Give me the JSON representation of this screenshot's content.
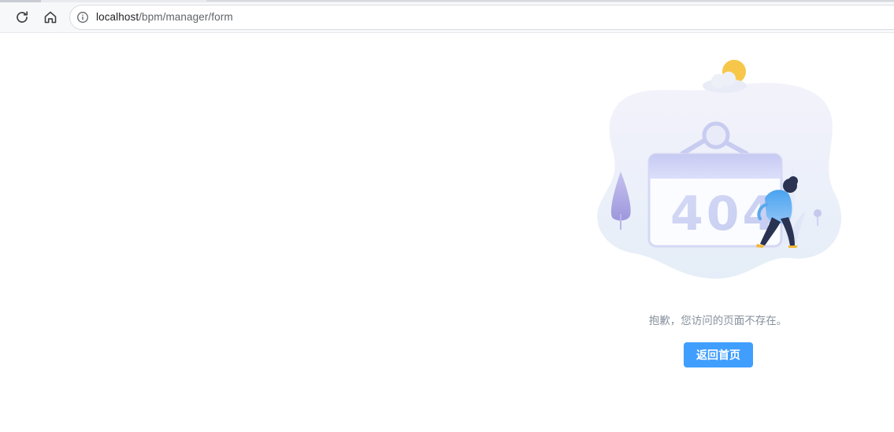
{
  "browser": {
    "url_host": "localhost",
    "url_path": "/bpm/manager/form"
  },
  "error_page": {
    "code": "404",
    "message": "抱歉，您访问的页面不存在。",
    "home_button_label": "返回首页"
  },
  "colors": {
    "primary": "#409eff",
    "message_text": "#86909c",
    "blob": "#eef1f9",
    "sun": "#f7c74a"
  }
}
